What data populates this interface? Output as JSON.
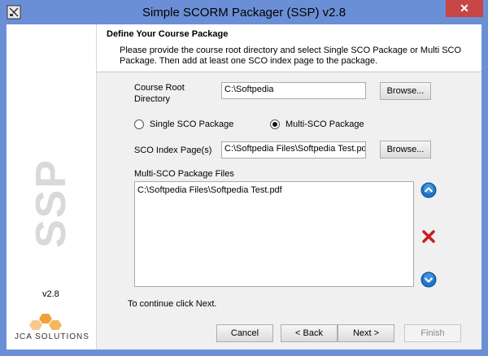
{
  "window": {
    "title": "Simple SCORM Packager (SSP) v2.8",
    "close_label": "✕"
  },
  "sidebar": {
    "brand_text": "SSP",
    "version": "v2.8",
    "logo_text": "JCA SOLUTIONS"
  },
  "header": {
    "title": "Define Your Course Package",
    "description": "Please provide the course root directory and select Single SCO Package or Multi SCO Package. Then add at least one SCO index page to the package."
  },
  "form": {
    "root_dir_label_line1": "Course Root",
    "root_dir_label_line2": "Directory",
    "root_dir_value": "C:\\Softpedia",
    "browse_label": "Browse...",
    "single_sco_label": "Single SCO Package",
    "multi_sco_label": "Multi-SCO Package",
    "selected_package": "Multi-SCO Package",
    "sco_index_label": "SCO Index Page(s)",
    "sco_index_value": "C:\\Softpedia Files\\Softpedia Test.pd",
    "files_label": "Multi-SCO Package Files",
    "files": [
      "C:\\Softpedia Files\\Softpedia Test.pdf"
    ]
  },
  "footer": {
    "message": "To continue click Next.",
    "cancel_label": "Cancel",
    "back_label": "< Back",
    "next_label": "Next >",
    "finish_label": "Finish"
  },
  "colors": {
    "accent_title": "#6b8fd6",
    "close": "#c74646",
    "blue_button": "#1f74c8",
    "delete_red": "#c81e1e"
  },
  "icons": {
    "up": "arrow-up-icon",
    "down": "arrow-down-icon",
    "delete": "delete-x-icon"
  }
}
